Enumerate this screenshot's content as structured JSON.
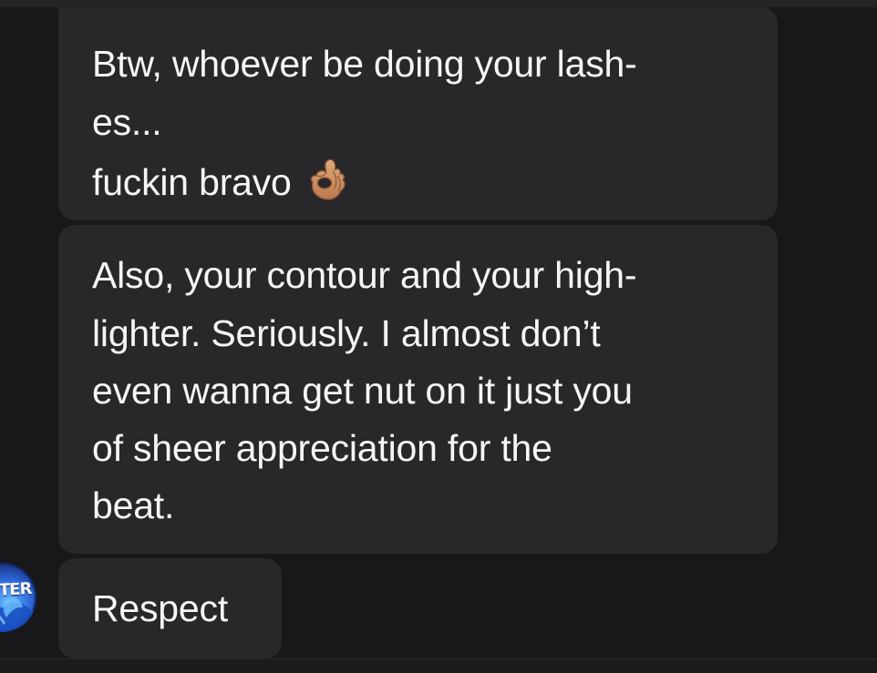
{
  "conversation": {
    "messages": [
      {
        "lines": [
          "Btw, whoever be doing your lash-",
          "es...",
          "fuckin bravo"
        ],
        "emoji": "ok-hand-icon"
      },
      {
        "lines": [
          "Also, your contour and your high-",
          "lighter. Seriously. I almost don’t",
          "even wanna get nut on it just you",
          "of sheer appreciation for the",
          "beat."
        ]
      },
      {
        "lines": [
          "Respect"
        ]
      }
    ],
    "avatar": {
      "label": "TER"
    }
  },
  "colors": {
    "background": "#18181a",
    "bubble": "#28282b",
    "text": "#f6f6f6",
    "avatar_blue": "#2c66d9"
  }
}
